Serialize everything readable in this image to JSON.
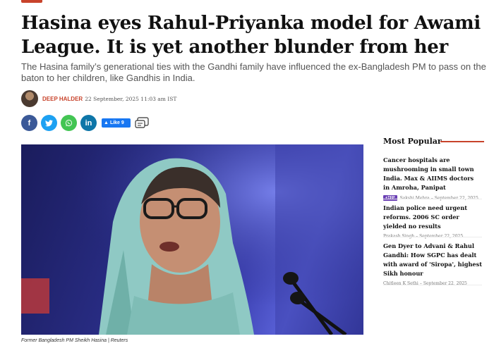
{
  "article": {
    "headline": "Hasina eyes Rahul-Priyanka model for Awami League. It is yet another blunder from her",
    "subheadline": "The Hasina family’s generational ties with the Gandhi family have influenced the ex-Bangladesh PM to pass on the baton to her children, like Gandhis in India.",
    "author": "DEEP HALDER",
    "published": "22 September, 2025 11:03 am IST",
    "image_caption": "Former Bangladesh PM Sheikh Hasina | Reuters"
  },
  "share": {
    "facebook_icon": "f",
    "twitter_icon": "t",
    "whatsapp_icon": "w",
    "linkedin_icon": "in",
    "like_label": "Like 9"
  },
  "sidebar": {
    "title": "Most Popular",
    "items": [
      {
        "title": "Cancer hospitals are mushrooming in small town India. Max & AIIMS doctors in Amroha, Panipat",
        "badge": "+TFP",
        "author": "Sakshi Mehra",
        "date": "September 22, 2025"
      },
      {
        "title": "Indian police need urgent reforms. 2006 SC order yielded no results",
        "badge": "",
        "author": "Prakash Singh",
        "date": "September 22, 2025"
      },
      {
        "title": "Gen Dyer to Advani & Rahul Gandhi: How SGPC has dealt with award of 'Siropa', highest Sikh honour",
        "badge": "",
        "author": "Chitleen K Sethi",
        "date": "September 22, 2025"
      }
    ]
  },
  "colors": {
    "accent": "#c8432b",
    "facebook": "#3b5998",
    "twitter": "#1da1f2",
    "whatsapp": "#43c553",
    "linkedin": "#0e76a8",
    "badge": "#6a3fb4"
  }
}
